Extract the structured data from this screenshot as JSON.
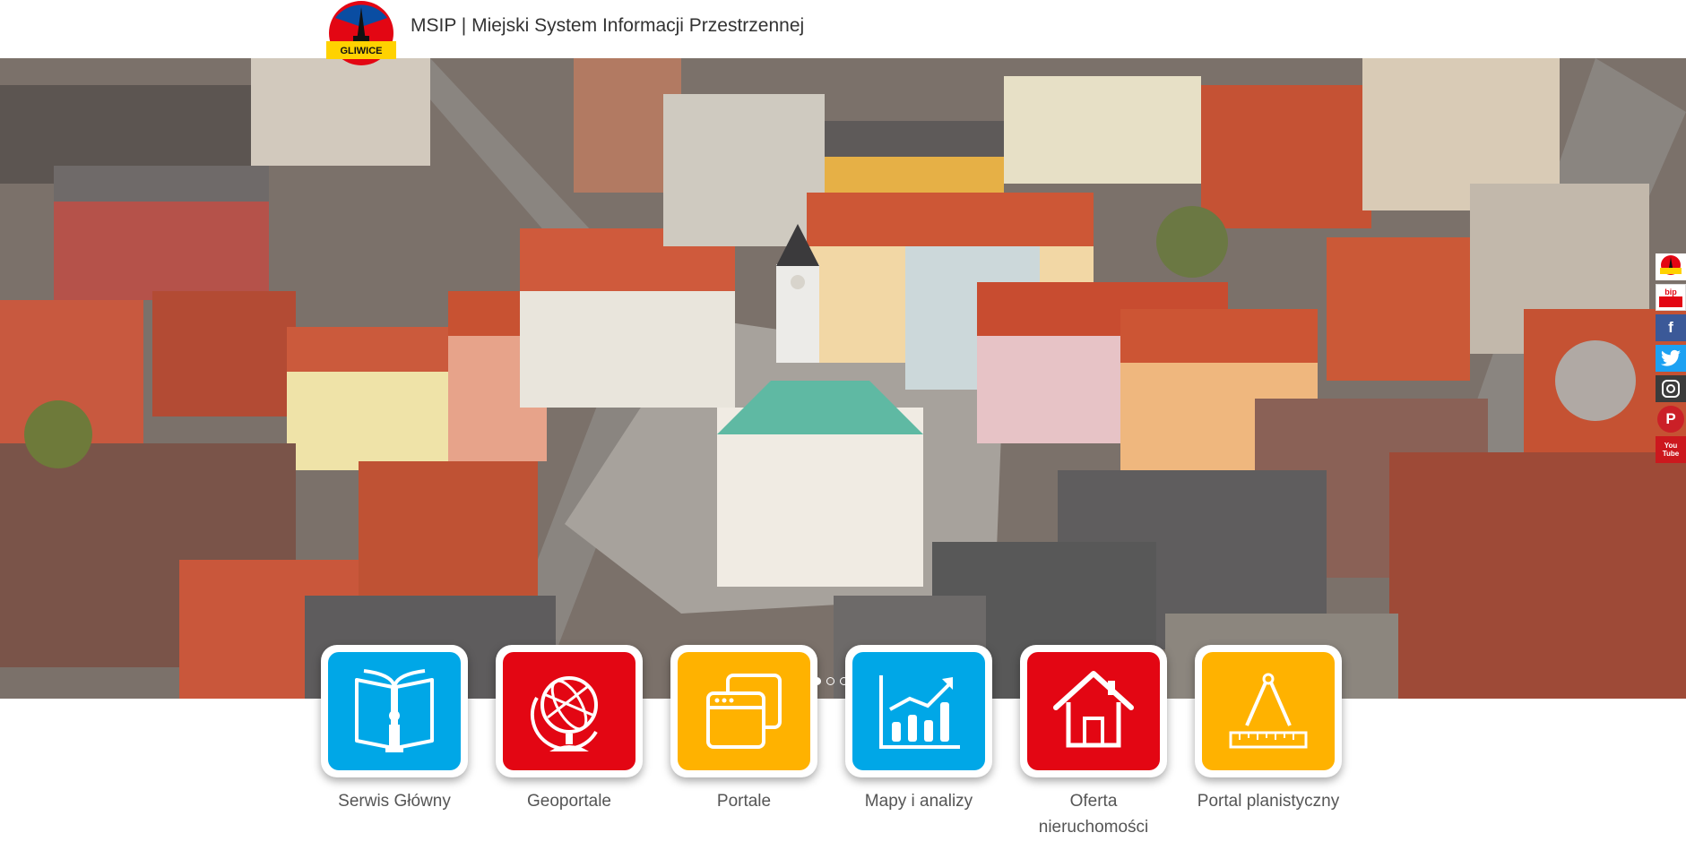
{
  "header": {
    "logo_text": "GLIWICE",
    "title": "MSIP | Miejski System Informacji Przestrzennej"
  },
  "hero": {
    "slides": 3,
    "active_slide": 1
  },
  "social": [
    {
      "name": "gliwice-logo-icon",
      "color": "#ffffff"
    },
    {
      "name": "bip-icon",
      "label": "bip",
      "color": "#ffffff"
    },
    {
      "name": "facebook-icon",
      "label": "f",
      "color": "#3b5998"
    },
    {
      "name": "twitter-icon",
      "color": "#1da1f2"
    },
    {
      "name": "instagram-icon",
      "color": "#3b3b3b"
    },
    {
      "name": "pinterest-icon",
      "label": "P",
      "color": "#cb2027"
    },
    {
      "name": "youtube-icon",
      "label": "You Tube",
      "color": "#cc181e"
    }
  ],
  "tiles": [
    {
      "label": "Serwis Główny",
      "color": "#00a7e7",
      "icon": "book-info-icon"
    },
    {
      "label": "Geoportale",
      "color": "#e30613",
      "icon": "globe-icon"
    },
    {
      "label": "Portale",
      "color": "#ffb200",
      "icon": "windows-icon"
    },
    {
      "label": "Mapy i analizy",
      "color": "#00a7e7",
      "icon": "chart-icon"
    },
    {
      "label": "Oferta nieruchomości",
      "color": "#e30613",
      "icon": "house-icon"
    },
    {
      "label": "Portal planistyczny",
      "color": "#ffb200",
      "icon": "compass-ruler-icon"
    }
  ]
}
